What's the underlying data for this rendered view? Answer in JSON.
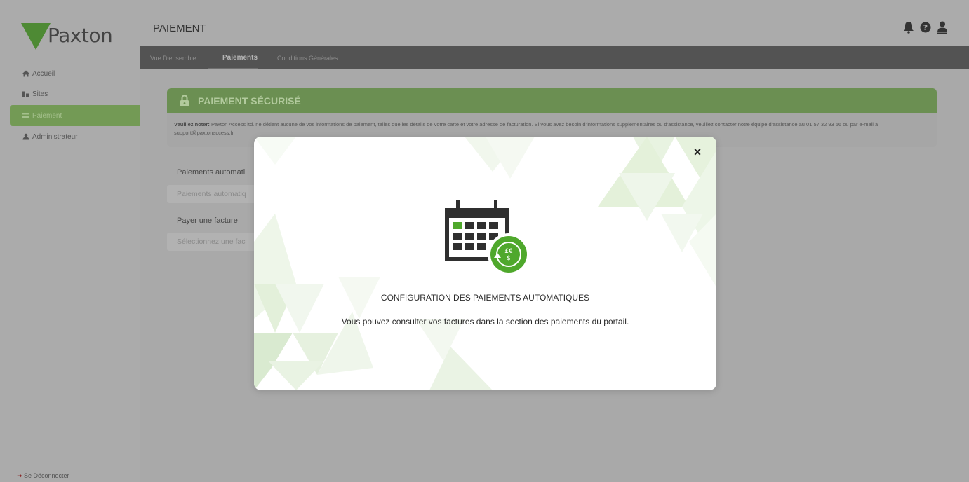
{
  "brand": {
    "name": "Paxton",
    "color": "#4e8a34"
  },
  "sidebar": {
    "items": [
      {
        "label": "Accueil",
        "icon": "home-icon"
      },
      {
        "label": "Sites",
        "icon": "building-icon"
      },
      {
        "label": "Paiement",
        "icon": "card-icon",
        "active": true
      },
      {
        "label": "Administrateur",
        "icon": "user-icon"
      }
    ],
    "logout": "Se Déconnecter"
  },
  "header": {
    "title": "PAIEMENT",
    "icons": [
      "bell-icon",
      "help-icon",
      "account-icon"
    ]
  },
  "tabs": [
    {
      "label": "Vue D'ensemble"
    },
    {
      "label": "Paiements",
      "active": true
    },
    {
      "label": "Conditions Générales"
    }
  ],
  "secure": {
    "title": "PAIEMENT SÉCURISÉ",
    "note_bold": "Veuillez noter:",
    "note_text": " Paxton Access ltd. ne détient aucune de vos informations de paiement, telles que les détails de votre carte et votre adresse de facturation. Si vous avez besoin d'informations supplémentaires ou d'assistance, veuillez contacter notre équipe d'assistance au 01 57 32 93 56 ou par e-mail à support@paxtonaccess.fr"
  },
  "form": {
    "auto_label": "Paiements automati",
    "auto_value": "Paiements automatiq",
    "invoice_label": "Payer une facture",
    "invoice_value": "Sélectionnez une fac"
  },
  "modal": {
    "title": "CONFIGURATION DES PAIEMENTS AUTOMATIQUES",
    "text": "Vous pouvez consulter vos factures dans la section des paiements du portail.",
    "close": "×",
    "icon": "calendar-recurring-payment-icon",
    "currency_symbols": "£€$",
    "accent": "#4fa82c"
  }
}
